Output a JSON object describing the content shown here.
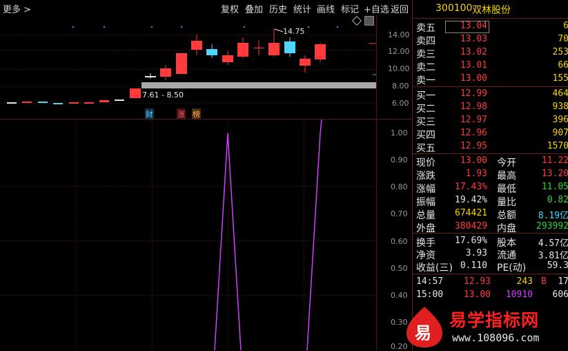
{
  "menu": {
    "more": "更多 >",
    "items": [
      "复权",
      "叠加",
      "历史",
      "统计",
      "画线",
      "标记",
      "+自选",
      "返回"
    ]
  },
  "kline": {
    "price_axis": [
      "14.00",
      "12.00",
      "10.00",
      "8.00",
      "6.00"
    ],
    "high_label": "14.75",
    "range_label": "7.61 - 8.50",
    "tags": [
      "财",
      "涨",
      "榜"
    ]
  },
  "indicator": {
    "axis": [
      "1.00",
      "0.90",
      "0.80",
      "0.70",
      "0.60",
      "0.50",
      "0.40",
      "0.30",
      "0.20"
    ]
  },
  "stock": {
    "code": "300100",
    "name": "双林股份"
  },
  "sell": [
    {
      "label": "卖五",
      "price": "13.04",
      "vol": "6"
    },
    {
      "label": "卖四",
      "price": "13.03",
      "vol": "70"
    },
    {
      "label": "卖三",
      "price": "13.02",
      "vol": "253"
    },
    {
      "label": "卖二",
      "price": "13.01",
      "vol": "66"
    },
    {
      "label": "卖一",
      "price": "13.00",
      "vol": "155"
    }
  ],
  "buy": [
    {
      "label": "买一",
      "price": "12.99",
      "vol": "464"
    },
    {
      "label": "买二",
      "price": "12.98",
      "vol": "938"
    },
    {
      "label": "买三",
      "price": "12.97",
      "vol": "396"
    },
    {
      "label": "买四",
      "price": "12.96",
      "vol": "907"
    },
    {
      "label": "买五",
      "price": "12.95",
      "vol": "1570"
    }
  ],
  "quote": [
    {
      "l1": "现价",
      "v1": "13.00",
      "l2": "今开",
      "v2": "11.22"
    },
    {
      "l1": "涨跌",
      "v1": "1.93",
      "l2": "最高",
      "v2": "13.20"
    },
    {
      "l1": "涨幅",
      "v1": "17.43%",
      "l2": "最低",
      "v2": "11.05"
    },
    {
      "l1": "振幅",
      "v1": "19.42%",
      "l2": "量比",
      "v2": "0.82"
    },
    {
      "l1": "总量",
      "v1": "674421",
      "l2": "总额",
      "v2": "8.19亿"
    },
    {
      "l1": "外盘",
      "v1": "380429",
      "l2": "内盘",
      "v2": "293992"
    }
  ],
  "fundamentals": [
    {
      "l1": "换手",
      "v1": "17.69%",
      "l2": "股本",
      "v2": "4.57亿"
    },
    {
      "l1": "净资",
      "v1": "3.93",
      "l2": "流通",
      "v2": "3.81亿"
    },
    {
      "l1": "收益(三)",
      "v1": "0.110",
      "l2": "PE(动)",
      "v2": "59.3"
    }
  ],
  "ticks": [
    {
      "time": "14:57",
      "price": "12.93",
      "vol": "243",
      "flag": "B",
      "extra": "17"
    },
    {
      "time": "15:00",
      "price": "13.00",
      "vol": "10910",
      "flag": "",
      "extra": "606"
    }
  ],
  "watermark": {
    "title": "易学指标网",
    "url": "www.108096.com",
    "logo": "易"
  },
  "colors": {
    "up": "#ff3b3b",
    "down": "#2fd63a",
    "flat": "#e6e6e6",
    "cyan": "#4fd6ff",
    "indicator": "#d040ff"
  }
}
